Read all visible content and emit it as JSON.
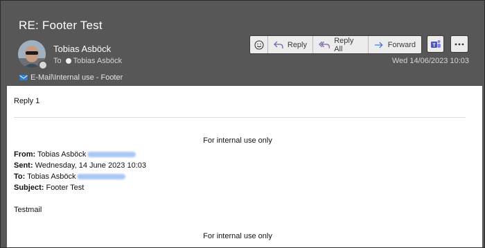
{
  "email": {
    "subject": "RE: Footer Test",
    "sender": "Tobias Asböck",
    "to_label": "To",
    "recipient": "Tobias Asböck",
    "folder": "E-Mail\\Internal use - Footer",
    "date": "Wed 14/06/2023 10:03"
  },
  "toolbar": {
    "reply": "Reply",
    "reply_all": "Reply All",
    "forward": "Forward"
  },
  "body": {
    "reply_text": "Reply 1",
    "footer_top": "For internal use only",
    "from_label": "From:",
    "from_value": "Tobias Asböck",
    "sent_label": "Sent:",
    "sent_value": "Wednesday, 14 June 2023 10:03",
    "to_label": "To:",
    "to_value": "Tobias Asböck",
    "subject_label": "Subject:",
    "subject_value": "Footer Test",
    "message": "Testmail",
    "footer_bottom": "For internal use only"
  },
  "icons": {
    "emoji": "smiley-icon",
    "reply": "reply-arrow-icon",
    "reply_all": "reply-all-arrow-icon",
    "forward": "forward-arrow-icon",
    "teams": "teams-icon",
    "more": "more-icon"
  },
  "colors": {
    "accent_purple": "#7b5ea7",
    "forward_blue": "#3a7bd5",
    "teams": "#4b53bc"
  }
}
